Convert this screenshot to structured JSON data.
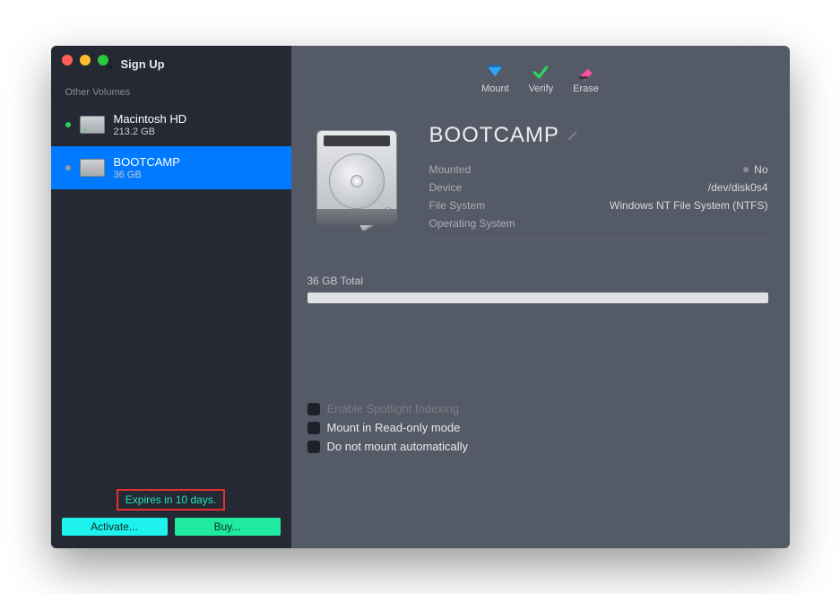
{
  "signup_label": "Sign Up",
  "section_label": "Other Volumes",
  "volumes": [
    {
      "name": "Macintosh HD",
      "size": "213.2 GB",
      "status": "green",
      "selected": false
    },
    {
      "name": "BOOTCAMP",
      "size": "36 GB",
      "status": "grey",
      "selected": true
    }
  ],
  "expires_text": "Expires in 10 days.",
  "activate_label": "Activate...",
  "buy_label": "Buy...",
  "toolbar": {
    "mount": "Mount",
    "verify": "Verify",
    "erase": "Erase"
  },
  "detail": {
    "title": "BOOTCAMP",
    "rows": {
      "mounted_key": "Mounted",
      "mounted_val": "No",
      "device_key": "Device",
      "device_val": "/dev/disk0s4",
      "fs_key": "File System",
      "fs_val": "Windows NT File System (NTFS)",
      "os_key": "Operating System",
      "os_val": ""
    },
    "usage_label": "36 GB Total"
  },
  "options": {
    "spotlight": "Enable Spotlight Indexing",
    "readonly": "Mount in Read-only mode",
    "noauto": "Do not mount automatically"
  }
}
